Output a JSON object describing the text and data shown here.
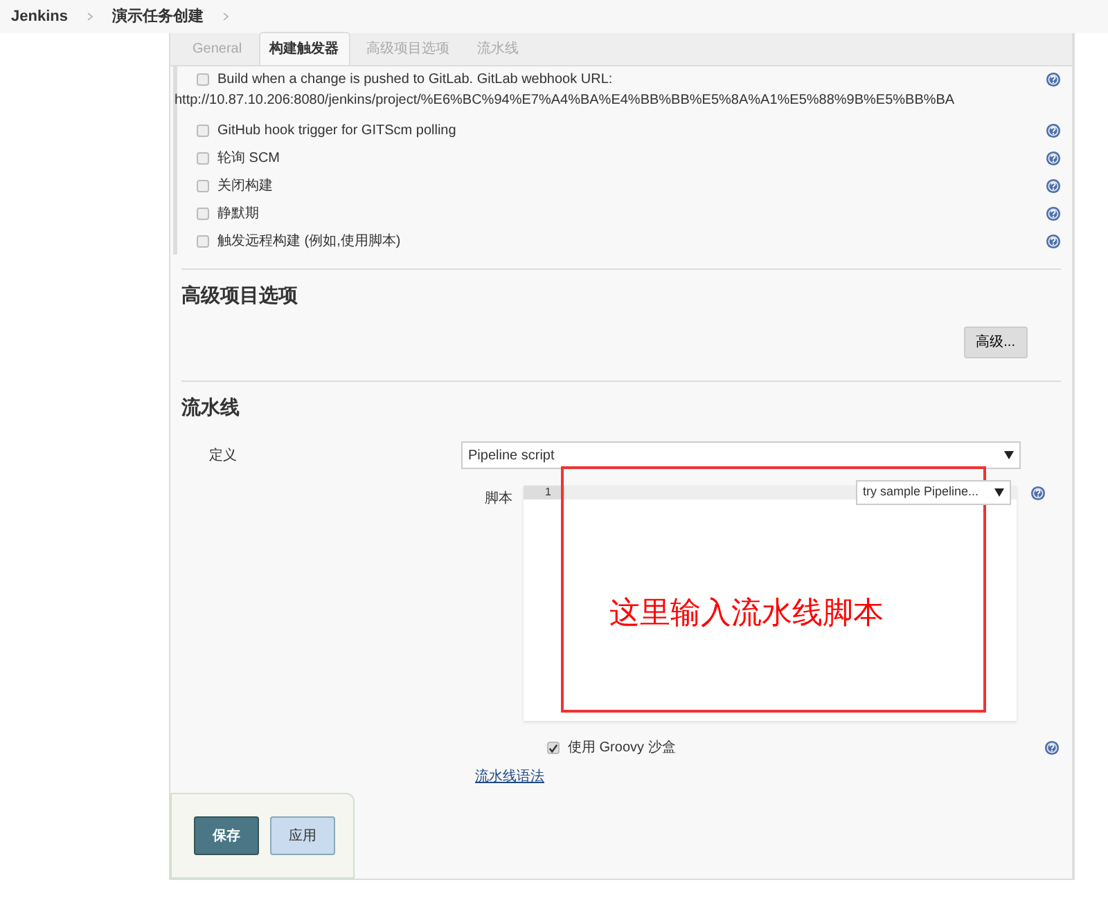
{
  "breadcrumb": [
    {
      "label": "Jenkins"
    },
    {
      "label": "演示任务创建"
    }
  ],
  "tabs": [
    {
      "label": "General",
      "selected": false
    },
    {
      "label": "构建触发器",
      "selected": true
    },
    {
      "label": "高级项目选项",
      "selected": false
    },
    {
      "label": "流水线",
      "selected": false
    }
  ],
  "triggers": [
    {
      "label": "Build when a change is pushed to GitLab. GitLab webhook URL:",
      "detail": "http://10.87.10.206:8080/jenkins/project/%E6%BC%94%E7%A4%BA%E4%BB%BB%E5%8A%A1%E5%88%9B%E5%BB%BA",
      "checked": false
    },
    {
      "label": "GitHub hook trigger for GITScm polling",
      "checked": false
    },
    {
      "label": "轮询 SCM",
      "checked": false
    },
    {
      "label": "关闭构建",
      "checked": false
    },
    {
      "label": "静默期",
      "checked": false
    },
    {
      "label": "触发远程构建 (例如,使用脚本)",
      "checked": false
    }
  ],
  "advanced_section": {
    "title": "高级项目选项",
    "button": "高级..."
  },
  "pipeline_section": {
    "title": "流水线",
    "definition_label": "定义",
    "definition_value": "Pipeline script",
    "script_label": "脚本",
    "line_number": "1",
    "sample_select": "try sample Pipeline...",
    "annotation": "这里输入流水线脚本",
    "sandbox": {
      "label": "使用 Groovy 沙盒",
      "checked": true
    },
    "syntax_link": "流水线语法"
  },
  "buttons": [
    {
      "label": "保存",
      "kind": "primary"
    },
    {
      "label": "应用",
      "kind": "secondary"
    }
  ]
}
